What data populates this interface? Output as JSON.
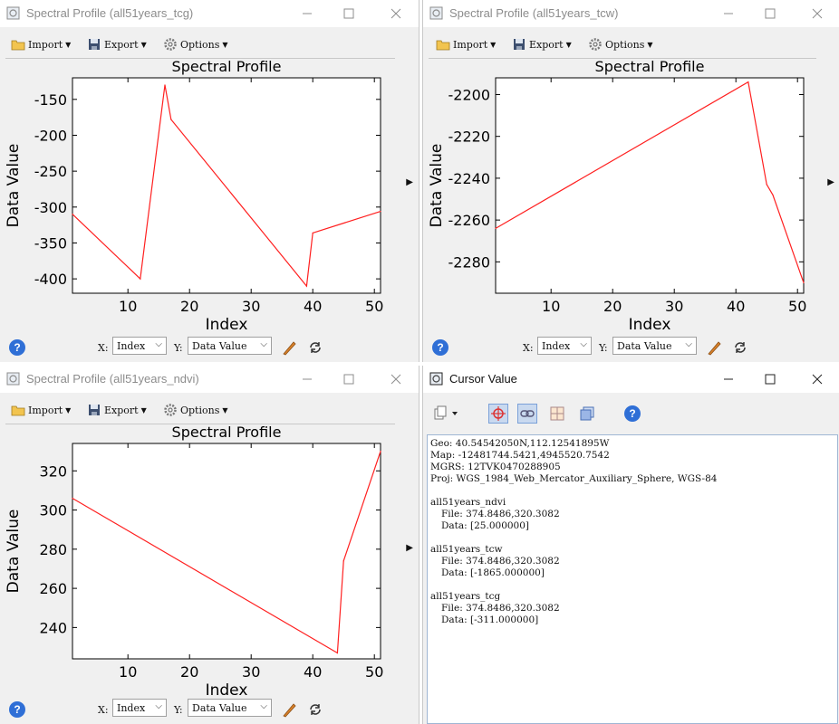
{
  "windows": {
    "tcg": {
      "title": "Spectral Profile (all51years_tcg)",
      "toolbar": {
        "import": "Import",
        "export": "Export",
        "options": "Options"
      },
      "chart_title": "Spectral Profile",
      "x_select": "Index",
      "y_select": "Data Value",
      "x_axis_label": "X:",
      "y_axis_label": "Y:"
    },
    "tcw": {
      "title": "Spectral Profile (all51years_tcw)",
      "toolbar": {
        "import": "Import",
        "export": "Export",
        "options": "Options"
      },
      "chart_title": "Spectral Profile",
      "x_select": "Index",
      "y_select": "Data Value",
      "x_axis_label": "X:",
      "y_axis_label": "Y:"
    },
    "ndvi": {
      "title": "Spectral Profile (all51years_ndvi)",
      "toolbar": {
        "import": "Import",
        "export": "Export",
        "options": "Options"
      },
      "chart_title": "Spectral Profile",
      "x_select": "Index",
      "y_select": "Data Value",
      "x_axis_label": "X:",
      "y_axis_label": "Y:"
    },
    "cursor": {
      "title": "Cursor Value",
      "geo": "Geo: 40.54542050N,112.12541895W",
      "map": "Map: -12481744.5421,4945520.7542",
      "mgrs": "MGRS: 12TVK0470288905",
      "proj": "Proj: WGS_1984_Web_Mercator_Auxiliary_Sphere, WGS-84",
      "entries": [
        {
          "name": "all51years_ndvi",
          "file": "File: 374.8486,320.3082",
          "data": "Data: [25.000000]"
        },
        {
          "name": "all51years_tcw",
          "file": "File: 374.8486,320.3082",
          "data": "Data: [-1865.000000]"
        },
        {
          "name": "all51years_tcg",
          "file": "File: 374.8486,320.3082",
          "data": "Data: [-311.000000]"
        }
      ]
    }
  },
  "help_symbol": "?",
  "colors": {
    "line": "#ff2020",
    "accent": "#2f6fd6"
  },
  "chart_data": [
    {
      "type": "line",
      "title": "Spectral Profile",
      "xlabel": "Index",
      "ylabel": "Data Value",
      "xlim": [
        1,
        51
      ],
      "ylim": [
        -420,
        -120
      ],
      "xticks": [
        10,
        20,
        30,
        40,
        50
      ],
      "yticks": [
        -400,
        -350,
        -300,
        -250,
        -200,
        -150
      ],
      "x": [
        1,
        12,
        16,
        17,
        39,
        40,
        51
      ],
      "y": [
        -310,
        -400,
        -130,
        -178,
        -410,
        -336,
        -306
      ]
    },
    {
      "type": "line",
      "title": "Spectral Profile",
      "xlabel": "Index",
      "ylabel": "Data Value",
      "xlim": [
        1,
        51
      ],
      "ylim": [
        -2295,
        -2192
      ],
      "xticks": [
        10,
        20,
        30,
        40,
        50
      ],
      "yticks": [
        -2280,
        -2260,
        -2240,
        -2220,
        -2200
      ],
      "x": [
        1,
        42,
        45,
        46,
        51
      ],
      "y": [
        -2264,
        -2194,
        -2243,
        -2248,
        -2290
      ]
    },
    {
      "type": "line",
      "title": "Spectral Profile",
      "xlabel": "Index",
      "ylabel": "Data Value",
      "xlim": [
        1,
        51
      ],
      "ylim": [
        224,
        334
      ],
      "xticks": [
        10,
        20,
        30,
        40,
        50
      ],
      "yticks": [
        240,
        260,
        280,
        300,
        320
      ],
      "x": [
        1,
        44,
        45,
        51
      ],
      "y": [
        306,
        227,
        274,
        330
      ]
    }
  ]
}
